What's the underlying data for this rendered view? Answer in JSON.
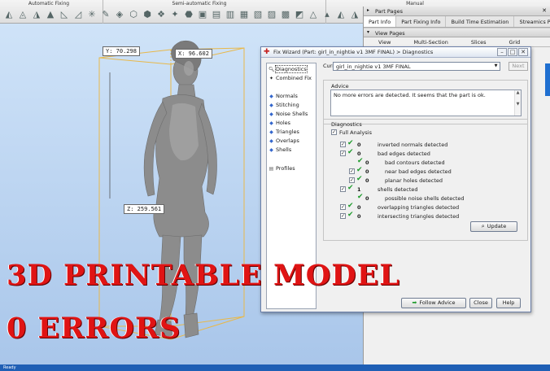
{
  "toolbar": {
    "groups": [
      "Automatic Fixing",
      "Semi-automatic Fixing",
      "Manual"
    ]
  },
  "viewport": {
    "coord_y": "Y: 70.298",
    "coord_x": "X: 96.602",
    "coord_z": "Z: 259.561"
  },
  "right_panel": {
    "title": "Part Pages",
    "tabs": [
      "Part Info",
      "Part Fixing Info",
      "Build Time Estimation",
      "Streamics Part Ta"
    ],
    "sub_title": "View Pages",
    "sub_tabs": [
      "View",
      "Multi-Section",
      "Slices",
      "Grid"
    ]
  },
  "dialog": {
    "title": "Fix Wizard (Part: girl_in_nightie v1 3MF FINAL) > Diagnostics",
    "nav": {
      "diagnostics": "Diagnostics",
      "combined_fix": "Combined Fix",
      "normals": "Normals",
      "stitching": "Stitching",
      "noise_shells": "Noise Shells",
      "holes": "Holes",
      "triangles": "Triangles",
      "overlaps": "Overlaps",
      "shells": "Shells",
      "profiles": "Profiles"
    },
    "current_part_label": "Current Part:",
    "current_part_value": "girl_in_nightie v1 3MF FINAL",
    "next_label": "Next",
    "advice_label": "Advice",
    "advice_text": "No more errors are detected. It seems that the part is ok.",
    "diagnostics_label": "Diagnostics",
    "full_analysis_label": "Full Analysis",
    "rows": {
      "inverted": {
        "count": "0",
        "label": "inverted normals detected"
      },
      "bad_edges": {
        "count": "0",
        "label": "bad edges detected"
      },
      "bad_contours": {
        "count": "0",
        "label": "bad contours detected"
      },
      "near_bad_edges": {
        "count": "0",
        "label": "near bad edges detected"
      },
      "planar_holes": {
        "count": "0",
        "label": "planar holes detected"
      },
      "shells": {
        "count": "1",
        "label": "shells detected"
      },
      "noise_shells": {
        "count": "0",
        "label": "possible noise shells detected"
      },
      "overlapping": {
        "count": "0",
        "label": "overlapping triangles detected"
      },
      "intersecting": {
        "count": "0",
        "label": "intersecting triangles detected"
      }
    },
    "update_label": "Update",
    "follow_advice_label": "Follow Advice",
    "close_label": "Close",
    "help_label": "Help"
  },
  "overlay": {
    "line1": "3D PRINTABLE MODEL",
    "line2": "0 ERRORS"
  },
  "statusbar": {
    "text": "Ready"
  },
  "colors": {
    "accent_red": "#e01414",
    "check_green": "#1c9a2a",
    "status_blue": "#1f5fb5"
  }
}
